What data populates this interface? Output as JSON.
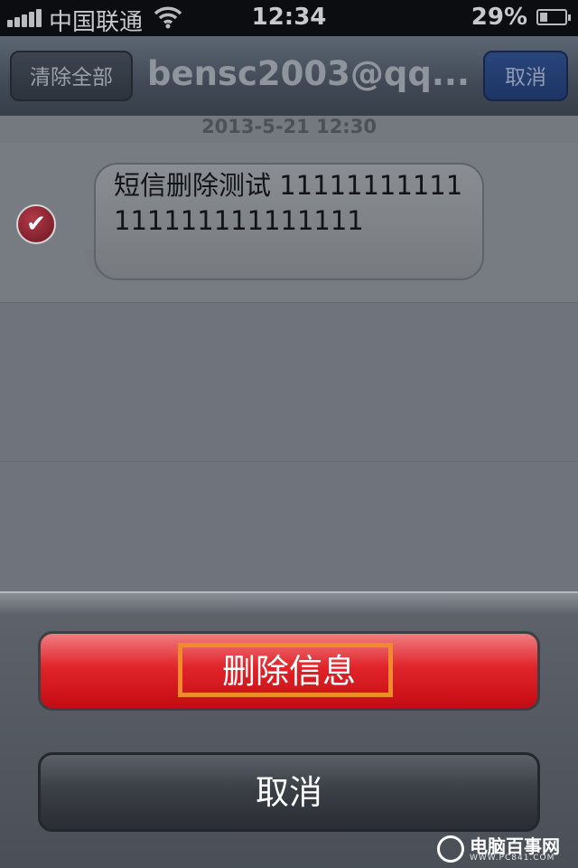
{
  "status_bar": {
    "carrier": "中国联通",
    "time": "12:34",
    "battery_percent": "29%",
    "battery_level": 0.29,
    "signal_icon": "signal-bars-icon",
    "wifi_icon": "wifi-icon"
  },
  "nav": {
    "left_button": "清除全部",
    "title": "bensc2003@qq....",
    "right_button": "取消"
  },
  "conversation": {
    "timestamp": "2013-5-21 12:30",
    "messages": [
      {
        "text": "短信删除测试 11111111111111111111111111",
        "selected": true
      }
    ]
  },
  "action_sheet": {
    "delete_label": "删除信息",
    "cancel_label": "取消",
    "delete_color": "#e0242a",
    "highlight_color": "#f08a2b"
  },
  "watermark": {
    "brand": "电脑百事网",
    "url": "WWW.PC841.COM"
  }
}
